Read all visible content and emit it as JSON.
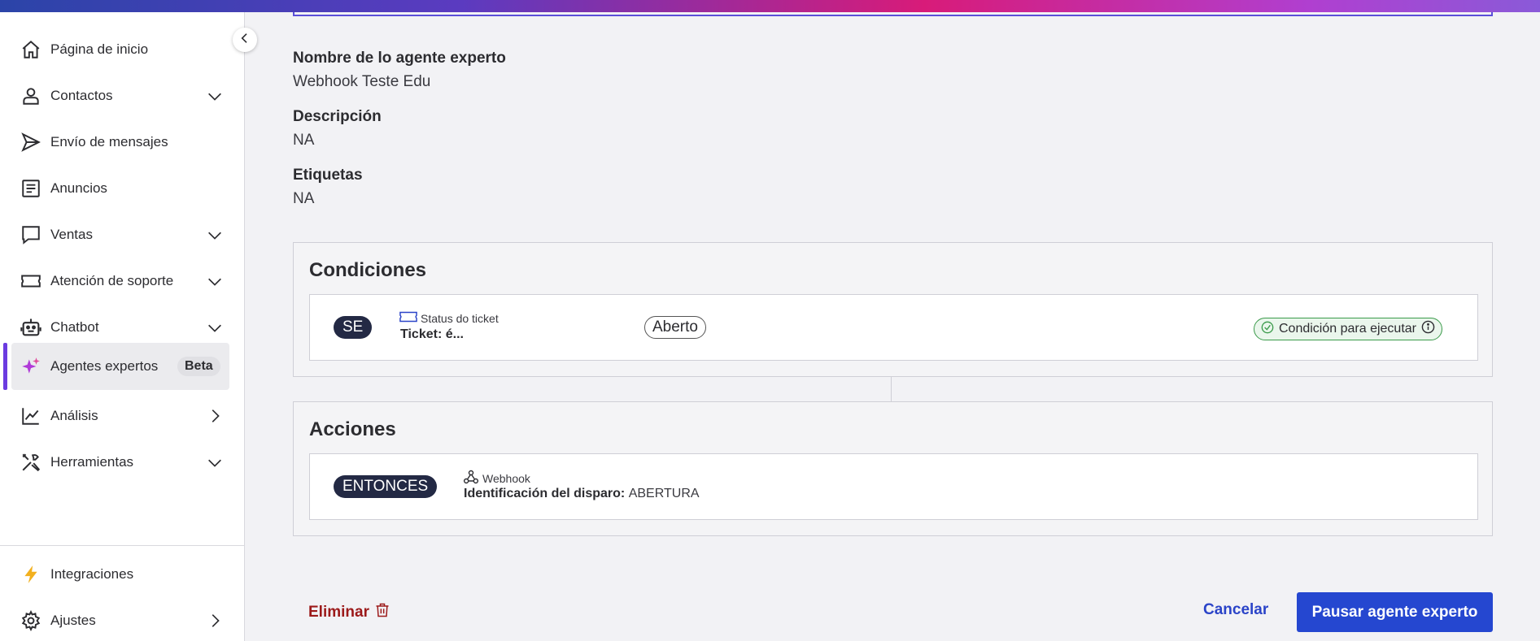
{
  "sidebar": {
    "items": [
      {
        "label": "Página de inicio",
        "icon": "home-icon"
      },
      {
        "label": "Contactos",
        "icon": "user-icon"
      },
      {
        "label": "Envío de mensajes",
        "icon": "send-icon"
      },
      {
        "label": "Anuncios",
        "icon": "document-icon"
      },
      {
        "label": "Ventas",
        "icon": "chat-bubble-icon"
      },
      {
        "label": "Atención de soporte",
        "icon": "ticket-icon"
      },
      {
        "label": "Chatbot",
        "icon": "robot-icon"
      },
      {
        "label": "Agentes expertos",
        "icon": "sparkles-icon",
        "badge": "Beta"
      },
      {
        "label": "Análisis",
        "icon": "chart-line-icon"
      },
      {
        "label": "Herramientas",
        "icon": "tools-icon"
      }
    ],
    "bottom_items": [
      {
        "label": "Integraciones",
        "icon": "lightning-icon"
      },
      {
        "label": "Ajustes",
        "icon": "gear-icon"
      }
    ]
  },
  "details": {
    "name_label": "Nombre de lo agente experto",
    "name_value": "Webhook Teste Edu",
    "description_label": "Descripción",
    "description_value": "NA",
    "tags_label": "Etiquetas",
    "tags_value": "NA"
  },
  "conditions": {
    "title": "Condiciones",
    "pill": "SE",
    "caption": "Status do ticket",
    "line": "Ticket: é...",
    "value": "Aberto",
    "badge": "Condición para ejecutar"
  },
  "actions": {
    "title": "Acciones",
    "pill": "ENTONCES",
    "caption": "Webhook",
    "line_label": "Identificación del disparo:",
    "line_value": "ABERTURA"
  },
  "footer": {
    "delete_label": "Eliminar",
    "cancel_label": "Cancelar",
    "primary_label": "Pausar agente experto"
  },
  "colors": {
    "accent": "#2547d0",
    "active_bar": "#6b3be0",
    "danger": "#9c1a1a",
    "success": "#3a9a4a"
  }
}
